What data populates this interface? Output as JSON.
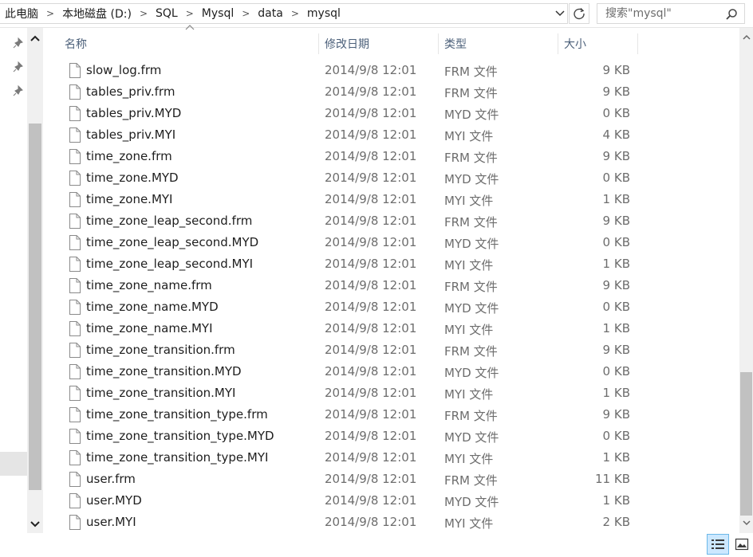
{
  "breadcrumb": [
    "此电脑",
    "本地磁盘 (D:)",
    "SQL",
    "Mysql",
    "data",
    "mysql"
  ],
  "search": {
    "placeholder": "搜索\"mysql\""
  },
  "columns": {
    "name": "名称",
    "date": "修改日期",
    "type": "类型",
    "size": "大小"
  },
  "files": [
    {
      "name": "slow_log.frm",
      "date": "2014/9/8 12:01",
      "type": "FRM 文件",
      "size": "9 KB"
    },
    {
      "name": "tables_priv.frm",
      "date": "2014/9/8 12:01",
      "type": "FRM 文件",
      "size": "9 KB"
    },
    {
      "name": "tables_priv.MYD",
      "date": "2014/9/8 12:01",
      "type": "MYD 文件",
      "size": "0 KB"
    },
    {
      "name": "tables_priv.MYI",
      "date": "2014/9/8 12:01",
      "type": "MYI 文件",
      "size": "4 KB"
    },
    {
      "name": "time_zone.frm",
      "date": "2014/9/8 12:01",
      "type": "FRM 文件",
      "size": "9 KB"
    },
    {
      "name": "time_zone.MYD",
      "date": "2014/9/8 12:01",
      "type": "MYD 文件",
      "size": "0 KB"
    },
    {
      "name": "time_zone.MYI",
      "date": "2014/9/8 12:01",
      "type": "MYI 文件",
      "size": "1 KB"
    },
    {
      "name": "time_zone_leap_second.frm",
      "date": "2014/9/8 12:01",
      "type": "FRM 文件",
      "size": "9 KB"
    },
    {
      "name": "time_zone_leap_second.MYD",
      "date": "2014/9/8 12:01",
      "type": "MYD 文件",
      "size": "0 KB"
    },
    {
      "name": "time_zone_leap_second.MYI",
      "date": "2014/9/8 12:01",
      "type": "MYI 文件",
      "size": "1 KB"
    },
    {
      "name": "time_zone_name.frm",
      "date": "2014/9/8 12:01",
      "type": "FRM 文件",
      "size": "9 KB"
    },
    {
      "name": "time_zone_name.MYD",
      "date": "2014/9/8 12:01",
      "type": "MYD 文件",
      "size": "0 KB"
    },
    {
      "name": "time_zone_name.MYI",
      "date": "2014/9/8 12:01",
      "type": "MYI 文件",
      "size": "1 KB"
    },
    {
      "name": "time_zone_transition.frm",
      "date": "2014/9/8 12:01",
      "type": "FRM 文件",
      "size": "9 KB"
    },
    {
      "name": "time_zone_transition.MYD",
      "date": "2014/9/8 12:01",
      "type": "MYD 文件",
      "size": "0 KB"
    },
    {
      "name": "time_zone_transition.MYI",
      "date": "2014/9/8 12:01",
      "type": "MYI 文件",
      "size": "1 KB"
    },
    {
      "name": "time_zone_transition_type.frm",
      "date": "2014/9/8 12:01",
      "type": "FRM 文件",
      "size": "9 KB"
    },
    {
      "name": "time_zone_transition_type.MYD",
      "date": "2014/9/8 12:01",
      "type": "MYD 文件",
      "size": "0 KB"
    },
    {
      "name": "time_zone_transition_type.MYI",
      "date": "2014/9/8 12:01",
      "type": "MYI 文件",
      "size": "1 KB"
    },
    {
      "name": "user.frm",
      "date": "2014/9/8 12:01",
      "type": "FRM 文件",
      "size": "11 KB"
    },
    {
      "name": "user.MYD",
      "date": "2014/9/8 12:01",
      "type": "MYD 文件",
      "size": "1 KB"
    },
    {
      "name": "user.MYI",
      "date": "2014/9/8 12:01",
      "type": "MYI 文件",
      "size": "2 KB"
    }
  ],
  "icons": {
    "file": "file-icon",
    "pin": "pin-icon",
    "refresh": "refresh-icon",
    "search": "search-icon",
    "dropdown": "chevron-down-icon",
    "sort": "sort-ascending-icon",
    "details_view": "details-view-icon",
    "large_icons_view": "large-icons-view-icon"
  },
  "colors": {
    "header_text": "#4c607a",
    "secondary_text": "#6d6d6d",
    "selected_view": "#cce8ff"
  }
}
